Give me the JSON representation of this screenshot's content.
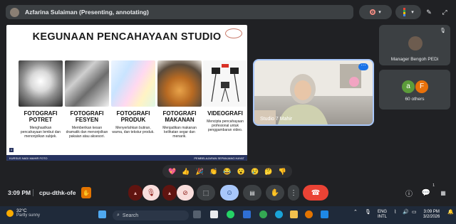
{
  "header": {
    "presenter_title": "Azfarina Sulaiman (Presenting, annotating)"
  },
  "slide": {
    "title": "KEGUNAAN PENCAHAYAAN STUDIO",
    "page_number": "4",
    "footer_left": "KURSUS NADI MAHIR FOTO",
    "footer_right": "PEMBELAJARAN SEPANJANG HAYAT",
    "cards": [
      {
        "heading": "FOTOGRAFI POTRET",
        "desc": "Menghasilkan pencahayaan lembut dan menonjolkan subjek."
      },
      {
        "heading": "FOTOGRAFI FESYEN",
        "desc": "Memberikan kesan dramatik dan menonjolkan pakaian atau aksesori."
      },
      {
        "heading": "FOTOGRAFI PRODUK",
        "desc": "Menyerlahkan butiran, warna, dan tekstur produk."
      },
      {
        "heading": "FOTOGRAFI MAKANAN",
        "desc": "Menjadikan makanan kelihatan segar dan menarik."
      },
      {
        "heading": "VIDEOGRAFI",
        "desc": "Mencipta pencahayaan profesional untuk penggambaran video."
      }
    ]
  },
  "participants": {
    "main_video_label": "Studio 7 Mahir",
    "side_tile_name": "Manager Bengoh PEDi",
    "others_count": "60 others",
    "others_initials": [
      "a",
      "F"
    ]
  },
  "reactions": [
    "💖",
    "👍",
    "🎉",
    "👏",
    "😂",
    "😮",
    "😢",
    "🤔",
    "👎"
  ],
  "meeting": {
    "time": "3:09 PM",
    "code": "cpu-dthk-ofe"
  },
  "taskbar": {
    "weather_temp": "32°C",
    "weather_desc": "Partly sunny",
    "search_placeholder": "Search",
    "lang_top": "ENG",
    "lang_bottom": "INTL",
    "clock_time": "3:09 PM",
    "clock_date": "3/2/2026",
    "notification_count": "1"
  },
  "colors": {
    "background": "#202124",
    "hangup": "#ea4335",
    "active_blue": "#a8c7fa"
  }
}
